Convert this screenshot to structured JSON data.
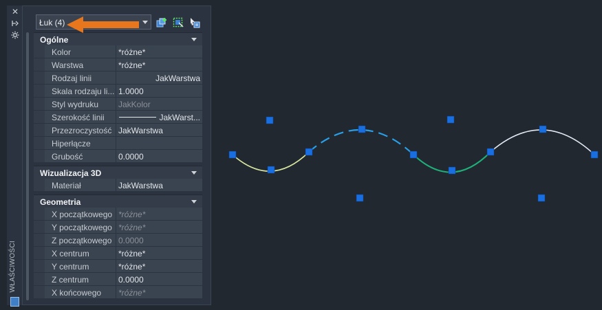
{
  "palette": {
    "title": "WŁAŚCIWOŚCI",
    "selector_value": "Łuk (4)"
  },
  "sections": [
    {
      "title": "Ogólne",
      "rows": [
        {
          "label": "Kolor",
          "value": "*różne*",
          "style": "normal"
        },
        {
          "label": "Warstwa",
          "value": "*różne*",
          "style": "normal"
        },
        {
          "label": "Rodzaj linii",
          "value": "JakWarstwa",
          "style": "right"
        },
        {
          "label": "Skala rodzaju li...",
          "value": "1.0000",
          "style": "normal"
        },
        {
          "label": "Styl wydruku",
          "value": "JakKolor",
          "style": "dimn"
        },
        {
          "label": "Szerokość linii",
          "value": "JakWarst...",
          "style": "lineweight"
        },
        {
          "label": "Przezroczystość",
          "value": "JakWarstwa",
          "style": "normal"
        },
        {
          "label": "Hiperłącze",
          "value": "",
          "style": "normal"
        },
        {
          "label": "Grubość",
          "value": "0.0000",
          "style": "normal"
        }
      ]
    },
    {
      "title": "Wizualizacja 3D",
      "rows": [
        {
          "label": "Materiał",
          "value": "JakWarstwa",
          "style": "normal"
        }
      ]
    },
    {
      "title": "Geometria",
      "rows": [
        {
          "label": "X początkowego",
          "value": "*różne*",
          "style": "dim"
        },
        {
          "label": "Y początkowego",
          "value": "*różne*",
          "style": "dim"
        },
        {
          "label": "Z początkowego",
          "value": "0.0000",
          "style": "dimn"
        },
        {
          "label": "X centrum",
          "value": "*różne*",
          "style": "normal"
        },
        {
          "label": "Y centrum",
          "value": "*różne*",
          "style": "normal"
        },
        {
          "label": "Z centrum",
          "value": "0.0000",
          "style": "normal"
        },
        {
          "label": "X końcowego",
          "value": "*różne*",
          "style": "dim"
        }
      ]
    }
  ],
  "colors": {
    "accent_arrow": "#e8761c",
    "grip": "#1a6fe0",
    "canvas_bg": "#212830"
  },
  "icons": [
    "close-icon",
    "pin-icon",
    "settings-icon",
    "quick-select-icon",
    "select-objects-icon",
    "toggle-pickadd-icon",
    "properties-palette-icon"
  ]
}
